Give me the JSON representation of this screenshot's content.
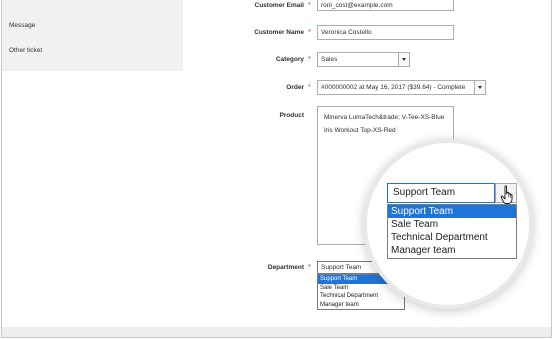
{
  "sidebar": {
    "items": [
      {
        "label": "Message"
      },
      {
        "label": "Other ticket"
      }
    ]
  },
  "form": {
    "customer_email": {
      "label": "Customer Email",
      "value": "roni_cost@example.com"
    },
    "customer_name": {
      "label": "Customer Name",
      "value": "Veronica Costello"
    },
    "category": {
      "label": "Category",
      "value": "Sales"
    },
    "order": {
      "label": "Order",
      "value": "#000000002 at May 16, 2017 ($39.64) - Complete"
    },
    "product": {
      "label": "Product",
      "options": [
        "Minerva LumaTech&trade; V-Tee-XS-Blue",
        "Iris Workout Top-XS-Red"
      ]
    },
    "department": {
      "label": "Department",
      "value": "Support Team",
      "options": [
        "Support Team",
        "Sale Team",
        "Technical Department",
        "Manager team"
      ],
      "selected_index": 0
    }
  },
  "magnifier": {
    "value": "Support Team",
    "options": [
      "Support Team",
      "Sale Team",
      "Technical Department",
      "Manager team"
    ]
  },
  "colors": {
    "required": "#e22626",
    "selection": "#1e74d9",
    "sidebar_bg": "#f1f1f1"
  }
}
